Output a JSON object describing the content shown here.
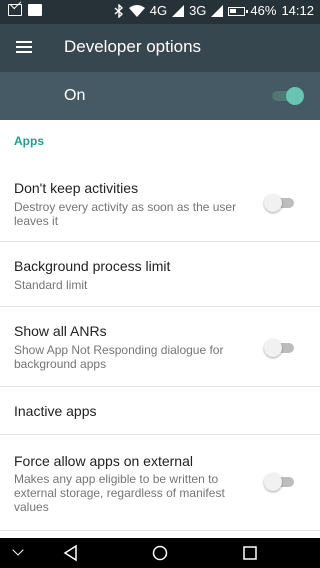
{
  "status_bar": {
    "network": "4G",
    "network2": "3G",
    "battery_percent": "46%",
    "time": "14:12"
  },
  "toolbar": {
    "title": "Developer options",
    "menu_icon": "hamburger-menu-icon"
  },
  "master_switch": {
    "label": "On",
    "checked": true,
    "accent": "#66c5b4"
  },
  "section": {
    "title": "Apps",
    "color": "#1e9e8d"
  },
  "settings": [
    {
      "title": "Don't keep activities",
      "subtitle": "Destroy every activity as soon as the user leaves it",
      "has_switch": true,
      "checked": false
    },
    {
      "title": "Background process limit",
      "subtitle": "Standard limit",
      "has_switch": false
    },
    {
      "title": "Show all ANRs",
      "subtitle": "Show App Not Responding dialogue for background apps",
      "has_switch": true,
      "checked": false
    },
    {
      "title": "Inactive apps",
      "subtitle": "",
      "has_switch": false
    },
    {
      "title": "Force allow apps on external",
      "subtitle": "Makes any app eligible to be written to external storage, regardless of manifest values",
      "has_switch": true,
      "checked": false
    }
  ],
  "nav_bar": {
    "icons": [
      "chevron-down-icon",
      "back-icon",
      "home-icon",
      "recents-icon"
    ]
  }
}
